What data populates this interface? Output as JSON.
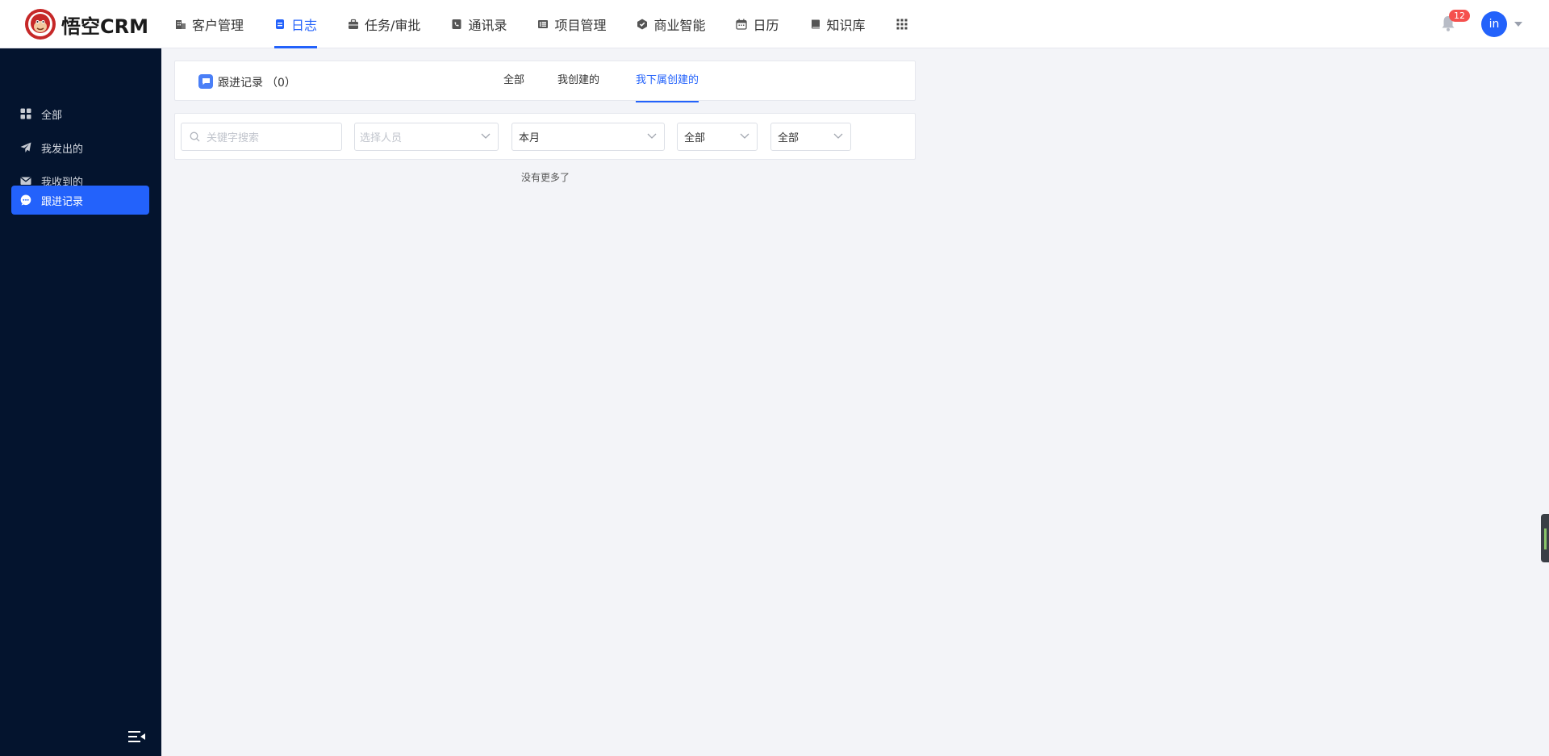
{
  "brand": {
    "name": "悟空CRM",
    "accent": "#2362fb",
    "logo_color": "#d32f2f"
  },
  "nav": {
    "items": [
      {
        "label": "客户管理",
        "icon": "building-icon"
      },
      {
        "label": "日志",
        "icon": "journal-icon",
        "active": true
      },
      {
        "label": "任务/审批",
        "icon": "briefcase-icon"
      },
      {
        "label": "通讯录",
        "icon": "phone-book-icon"
      },
      {
        "label": "项目管理",
        "icon": "project-icon"
      },
      {
        "label": "商业智能",
        "icon": "bi-icon"
      },
      {
        "label": "日历",
        "icon": "calendar-icon"
      },
      {
        "label": "知识库",
        "icon": "book-icon"
      }
    ],
    "apps_icon": "grid-apps-icon"
  },
  "header_right": {
    "notification_count": "12",
    "avatar_text": "in"
  },
  "sidebar": {
    "items": [
      {
        "label": "全部",
        "icon": "dashboard-icon"
      },
      {
        "label": "我发出的",
        "icon": "send-icon"
      },
      {
        "label": "我收到的",
        "icon": "envelope-icon"
      },
      {
        "label": "跟进记录",
        "icon": "chat-icon",
        "active": true
      }
    ],
    "collapse_icon": "menu-collapse-icon"
  },
  "panel": {
    "title": "跟进记录",
    "count": "（0）",
    "tabs": [
      {
        "label": "全部"
      },
      {
        "label": "我创建的"
      },
      {
        "label": "我下属创建的",
        "active": true
      }
    ]
  },
  "filters": {
    "search_placeholder": "关键字搜索",
    "person_placeholder": "选择人员",
    "period_value": "本月",
    "type_value": "全部",
    "type2_value": "全部"
  },
  "list": {
    "empty_text": "没有更多了"
  }
}
